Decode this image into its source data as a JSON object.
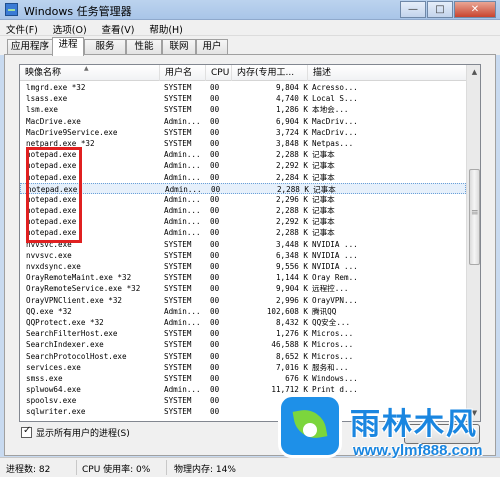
{
  "window": {
    "title": "Windows 任务管理器"
  },
  "menu": [
    "文件(F)",
    "选项(O)",
    "查看(V)",
    "帮助(H)"
  ],
  "tabs": [
    {
      "label": "应用程序",
      "active": false
    },
    {
      "label": "进程",
      "active": true
    },
    {
      "label": "服务",
      "active": false
    },
    {
      "label": "性能",
      "active": false
    },
    {
      "label": "联网",
      "active": false
    },
    {
      "label": "用户",
      "active": false
    }
  ],
  "columns": {
    "name": "映像名称",
    "user": "用户名",
    "cpu": "CPU",
    "mem": "内存(专用工...",
    "desc": "描述"
  },
  "processes": [
    {
      "name": "lmgrd.exe *32",
      "user": "SYSTEM",
      "cpu": "00",
      "mem": "9,804 K",
      "desc": "Acresso..."
    },
    {
      "name": "lsass.exe",
      "user": "SYSTEM",
      "cpu": "00",
      "mem": "4,740 K",
      "desc": "Local S..."
    },
    {
      "name": "lsm.exe",
      "user": "SYSTEM",
      "cpu": "00",
      "mem": "1,286 K",
      "desc": "本地会..."
    },
    {
      "name": "MacDrive.exe",
      "user": "Admin...",
      "cpu": "00",
      "mem": "6,904 K",
      "desc": "MacDriv..."
    },
    {
      "name": "MacDrive9Service.exe",
      "user": "SYSTEM",
      "cpu": "00",
      "mem": "3,724 K",
      "desc": "MacDriv..."
    },
    {
      "name": "netpard.exe *32",
      "user": "SYSTEM",
      "cpu": "00",
      "mem": "3,848 K",
      "desc": "Netpas..."
    },
    {
      "name": "notepad.exe",
      "user": "Admin...",
      "cpu": "00",
      "mem": "2,288 K",
      "desc": "记事本"
    },
    {
      "name": "notepad.exe",
      "user": "Admin...",
      "cpu": "00",
      "mem": "2,292 K",
      "desc": "记事本"
    },
    {
      "name": "notepad.exe",
      "user": "Admin...",
      "cpu": "00",
      "mem": "2,284 K",
      "desc": "记事本"
    },
    {
      "name": "notepad.exe",
      "user": "Admin...",
      "cpu": "00",
      "mem": "2,288 K",
      "desc": "记事本"
    },
    {
      "name": "notepad.exe",
      "user": "Admin...",
      "cpu": "00",
      "mem": "2,296 K",
      "desc": "记事本"
    },
    {
      "name": "notepad.exe",
      "user": "Admin...",
      "cpu": "00",
      "mem": "2,288 K",
      "desc": "记事本"
    },
    {
      "name": "notepad.exe",
      "user": "Admin...",
      "cpu": "00",
      "mem": "2,292 K",
      "desc": "记事本"
    },
    {
      "name": "notepad.exe",
      "user": "Admin...",
      "cpu": "00",
      "mem": "2,288 K",
      "desc": "记事本"
    },
    {
      "name": "nvvsvc.exe",
      "user": "SYSTEM",
      "cpu": "00",
      "mem": "3,448 K",
      "desc": "NVIDIA ..."
    },
    {
      "name": "nvvsvc.exe",
      "user": "SYSTEM",
      "cpu": "00",
      "mem": "6,348 K",
      "desc": "NVIDIA ..."
    },
    {
      "name": "nvxdsync.exe",
      "user": "SYSTEM",
      "cpu": "00",
      "mem": "9,556 K",
      "desc": "NVIDIA ..."
    },
    {
      "name": "OrayRemoteMaint.exe *32",
      "user": "SYSTEM",
      "cpu": "00",
      "mem": "1,144 K",
      "desc": "Oray Rem..."
    },
    {
      "name": "OrayRemoteService.exe *32",
      "user": "SYSTEM",
      "cpu": "00",
      "mem": "9,904 K",
      "desc": "远程控..."
    },
    {
      "name": "OrayVPNClient.exe *32",
      "user": "SYSTEM",
      "cpu": "00",
      "mem": "2,996 K",
      "desc": "OrayVPN..."
    },
    {
      "name": "QQ.exe *32",
      "user": "Admin...",
      "cpu": "00",
      "mem": "102,608 K",
      "desc": "腾讯QQ"
    },
    {
      "name": "QQProtect.exe *32",
      "user": "Admin...",
      "cpu": "00",
      "mem": "8,432 K",
      "desc": "QQ安全..."
    },
    {
      "name": "SearchFilterHost.exe",
      "user": "SYSTEM",
      "cpu": "00",
      "mem": "1,276 K",
      "desc": "Micros..."
    },
    {
      "name": "SearchIndexer.exe",
      "user": "SYSTEM",
      "cpu": "00",
      "mem": "46,588 K",
      "desc": "Micros..."
    },
    {
      "name": "SearchProtocolHost.exe",
      "user": "SYSTEM",
      "cpu": "00",
      "mem": "8,652 K",
      "desc": "Micros..."
    },
    {
      "name": "services.exe",
      "user": "SYSTEM",
      "cpu": "00",
      "mem": "7,016 K",
      "desc": "服务和..."
    },
    {
      "name": "smss.exe",
      "user": "SYSTEM",
      "cpu": "00",
      "mem": "676 K",
      "desc": "Windows..."
    },
    {
      "name": "splwow64.exe",
      "user": "Admin...",
      "cpu": "00",
      "mem": "11,712 K",
      "desc": "Print d..."
    },
    {
      "name": "spoolsv.exe",
      "user": "SYSTEM",
      "cpu": "00",
      "mem": "6",
      "desc": ""
    },
    {
      "name": "sqlwriter.exe",
      "user": "SYSTEM",
      "cpu": "00",
      "mem": "",
      "desc": ""
    }
  ],
  "selected_index": 9,
  "show_all_users": {
    "label": "显示所有用户的进程(S)",
    "checked": true
  },
  "status": {
    "processes": "进程数: 82",
    "cpu": "CPU 使用率: 0%",
    "memory": "物理内存: 14%"
  },
  "watermark": {
    "title": "雨林木风",
    "url": "www.ylmf888.com"
  }
}
